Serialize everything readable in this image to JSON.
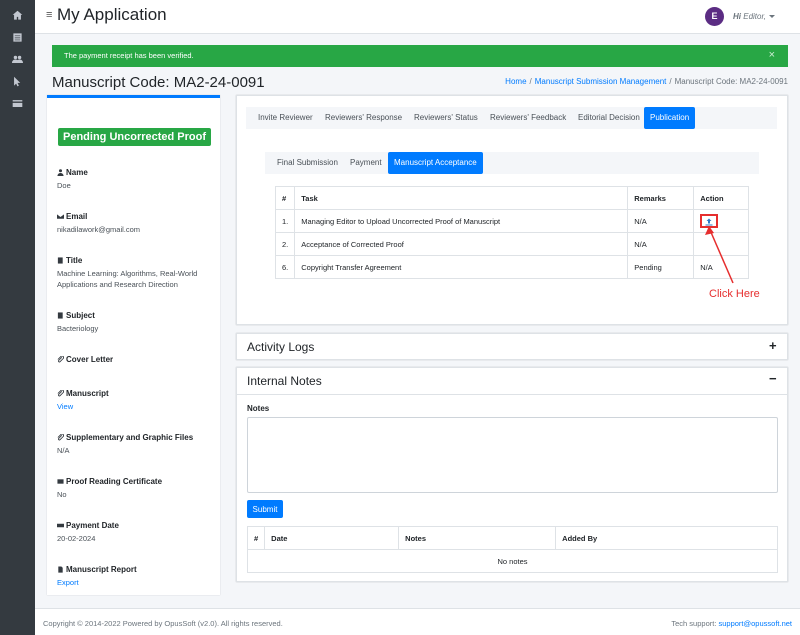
{
  "app": {
    "title": "My Application"
  },
  "colors": {
    "primary": "#007bff",
    "success": "#28a745",
    "sidebar": "#343a40",
    "avatar": "#5b2c83",
    "annotation": "#e62e2e"
  },
  "sidebar": {
    "icons": [
      "home-icon",
      "list-icon",
      "users-icon",
      "pointer-icon",
      "card-icon"
    ]
  },
  "user": {
    "initial": "E",
    "greeting": "Hi",
    "name": "Editor,"
  },
  "alert": {
    "message": "The payment receipt has been verified.",
    "close": "×"
  },
  "page": {
    "title": "Manuscript Code: MA2-24-0091"
  },
  "breadcrumb": {
    "home": "Home",
    "section": "Manuscript Submission Management",
    "current": "Manuscript Code: MA2-24-0091",
    "separator": "/"
  },
  "status_badge": "Pending Uncorrected Proof",
  "details": {
    "name": {
      "label": "Name",
      "value": "Doe"
    },
    "email": {
      "label": "Email",
      "value": "nikadilawork@gmail.com"
    },
    "title": {
      "label": "Title",
      "value": "Machine Learning: Algorithms, Real-World Applications and Research Direction"
    },
    "subject": {
      "label": "Subject",
      "value": "Bacteriology"
    },
    "cover_letter": {
      "label": "Cover Letter"
    },
    "manuscript": {
      "label": "Manuscript",
      "value": "View"
    },
    "supplementary": {
      "label": "Supplementary and Graphic Files",
      "value": "N/A"
    },
    "proof_cert": {
      "label": "Proof Reading Certificate",
      "value": "No"
    },
    "payment_date": {
      "label": "Payment Date",
      "value": "20-02-2024"
    },
    "report": {
      "label": "Manuscript Report",
      "value": "Export"
    }
  },
  "tabs": [
    {
      "label": "Invite Reviewer",
      "active": false
    },
    {
      "label": "Reviewers' Response",
      "active": false
    },
    {
      "label": "Reviewers' Status",
      "active": false
    },
    {
      "label": "Reviewers' Feedback",
      "active": false
    },
    {
      "label": "Editorial Decision",
      "active": false
    },
    {
      "label": "Publication",
      "active": true
    }
  ],
  "subtabs": [
    {
      "label": "Final Submission",
      "active": false
    },
    {
      "label": "Payment",
      "active": false
    },
    {
      "label": "Manuscript Acceptance",
      "active": true
    }
  ],
  "task_table": {
    "headers": {
      "num": "#",
      "task": "Task",
      "remarks": "Remarks",
      "action": "Action"
    },
    "rows": [
      {
        "num": "1.",
        "task": "Managing Editor to Upload Uncorrected Proof of Manuscript",
        "remarks": "N/A",
        "action_icon": "upload-icon"
      },
      {
        "num": "2.",
        "task": "Acceptance of Corrected Proof",
        "remarks": "N/A",
        "action": ""
      },
      {
        "num": "6.",
        "task": "Copyright Transfer Agreement",
        "remarks": "Pending",
        "action": "N/A"
      }
    ]
  },
  "annotation": {
    "text": "Click Here"
  },
  "activity_logs": {
    "title": "Activity Logs",
    "toggle": "+"
  },
  "internal_notes": {
    "title": "Internal Notes",
    "toggle": "−",
    "notes_label": "Notes",
    "notes_value": "",
    "submit": "Submit",
    "table": {
      "headers": {
        "num": "#",
        "date": "Date",
        "notes": "Notes",
        "added_by": "Added By"
      },
      "empty": "No notes"
    }
  },
  "footer": {
    "copyright": "Copyright © 2014-2022 Powered by OpusSoft (v2.0). All rights reserved.",
    "support_label": "Tech support:",
    "support_email": "support@opussoft.net"
  }
}
